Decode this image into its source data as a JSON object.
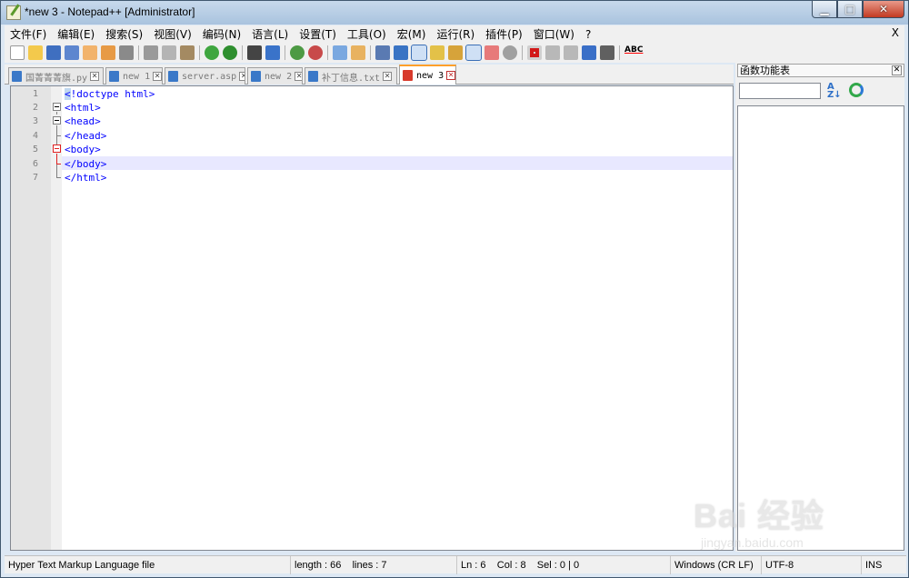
{
  "window": {
    "title": "*new 3 - Notepad++ [Administrator]",
    "minimize": "▁",
    "maximize": "□",
    "close": "✕"
  },
  "menu": {
    "items": [
      "文件(F)",
      "编辑(E)",
      "搜索(S)",
      "视图(V)",
      "编码(N)",
      "语言(L)",
      "设置(T)",
      "工具(O)",
      "宏(M)",
      "运行(R)",
      "插件(P)",
      "窗口(W)",
      "?"
    ],
    "close": "X"
  },
  "toolbar": {
    "icons": [
      "new-file-icon",
      "open-file-icon",
      "save-icon",
      "save-all-icon",
      "close-icon",
      "close-all-icon",
      "print-icon",
      "cut-icon",
      "copy-icon",
      "paste-icon",
      "undo-icon",
      "redo-icon",
      "find-icon",
      "replace-icon",
      "zoom-in-icon",
      "zoom-out-icon",
      "sync-vertical-icon",
      "sync-horizontal-icon",
      "word-wrap-icon",
      "show-all-chars-icon",
      "indent-guide-icon",
      "user-lang-icon",
      "doc-map-icon",
      "function-list-icon",
      "folder-workspace-icon",
      "monitoring-icon",
      "record-macro-icon",
      "stop-macro-icon",
      "play-macro-icon",
      "run-macro-multiple-icon",
      "save-macro-icon",
      "spellcheck-icon"
    ],
    "spell_label": "ABC"
  },
  "tabs": [
    {
      "label": "国菁菁菁旗.py",
      "icon": "blue",
      "active": false
    },
    {
      "label": "new 1",
      "icon": "blue",
      "active": false
    },
    {
      "label": "server.asp",
      "icon": "blue",
      "active": false
    },
    {
      "label": "new 2",
      "icon": "blue",
      "active": false
    },
    {
      "label": "补丁信息.txt",
      "icon": "blue",
      "active": false
    },
    {
      "label": "new 3",
      "icon": "red",
      "active": true
    }
  ],
  "editor": {
    "lines": [
      {
        "num": "1",
        "text": "<!doctype html>"
      },
      {
        "num": "2",
        "text": "<html>"
      },
      {
        "num": "3",
        "text": "<head>"
      },
      {
        "num": "4",
        "text": "</head>"
      },
      {
        "num": "5",
        "text": "<body>"
      },
      {
        "num": "6",
        "text": "</body>"
      },
      {
        "num": "7",
        "text": "</html>"
      }
    ],
    "current_line": 6
  },
  "function_list": {
    "title": "函数功能表",
    "close": "✕",
    "search_value": ""
  },
  "status": {
    "file_type": "Hyper Text Markup Language file",
    "length": "length : 66",
    "lines": "lines : 7",
    "ln": "Ln : 6",
    "col": "Col : 8",
    "sel": "Sel : 0 | 0",
    "eol": "Windows (CR LF)",
    "encoding": "UTF-8",
    "mode": "INS"
  },
  "watermark": {
    "main": "Bai 经验",
    "sub": "jingyan.baidu.com"
  },
  "colors": {
    "tag_blue": "#0000ff",
    "current_line": "#e8e8ff",
    "active_tab_accent": "#ff9f2a"
  }
}
